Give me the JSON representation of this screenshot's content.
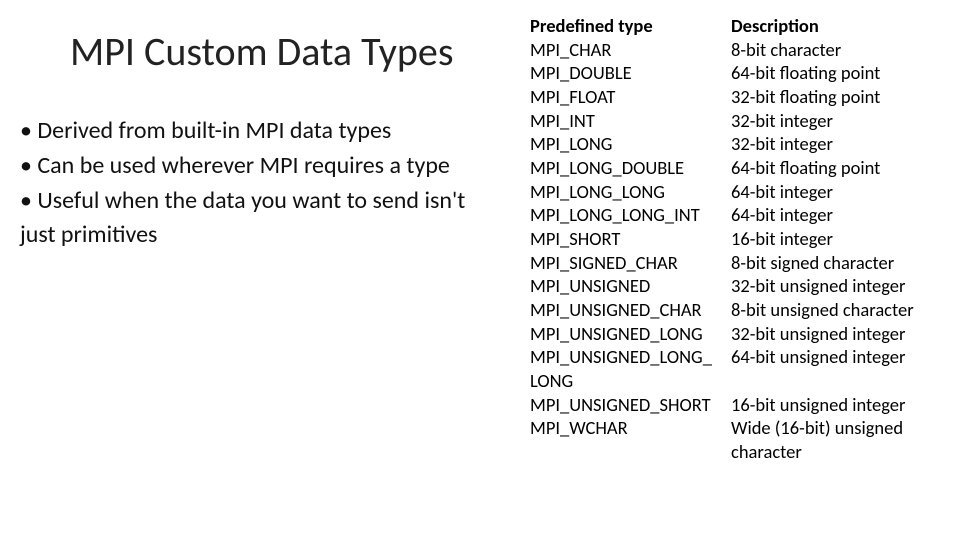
{
  "title": "MPI Custom Data Types",
  "bullets": [
    "• Derived from built-in MPI data types",
    "• Can be used wherever MPI requires a type",
    "• Useful when the data you want to send isn't",
    "just primitives"
  ],
  "table": {
    "head": {
      "type": "Predefined type",
      "desc": "Description"
    },
    "rows": [
      {
        "type": "MPI_CHAR",
        "desc": "8-bit character"
      },
      {
        "type": "MPI_DOUBLE",
        "desc": "64-bit floating point"
      },
      {
        "type": "MPI_FLOAT",
        "desc": "32-bit floating point"
      },
      {
        "type": "MPI_INT",
        "desc": "32-bit integer"
      },
      {
        "type": "MPI_LONG",
        "desc": "32-bit integer"
      },
      {
        "type": "MPI_LONG_DOUBLE",
        "desc": "64-bit floating point"
      },
      {
        "type": "MPI_LONG_LONG",
        "desc": "64-bit integer"
      },
      {
        "type": "MPI_LONG_LONG_INT",
        "desc": "64-bit integer"
      },
      {
        "type": "MPI_SHORT",
        "desc": "16-bit integer"
      },
      {
        "type": "MPI_SIGNED_CHAR",
        "desc": "8-bit signed character"
      },
      {
        "type": "MPI_UNSIGNED",
        "desc": "32-bit unsigned integer"
      },
      {
        "type": "MPI_UNSIGNED_CHAR",
        "desc": "8-bit unsigned character"
      },
      {
        "type": "MPI_UNSIGNED_LONG",
        "desc": "32-bit unsigned integer"
      },
      {
        "type": "MPI_UNSIGNED_LONG_ LONG",
        "desc": "64-bit unsigned integer"
      },
      {
        "type": "MPI_UNSIGNED_SHORT",
        "desc": "16-bit unsigned integer"
      },
      {
        "type": "MPI_WCHAR",
        "desc": "Wide (16-bit) unsigned character"
      }
    ]
  }
}
